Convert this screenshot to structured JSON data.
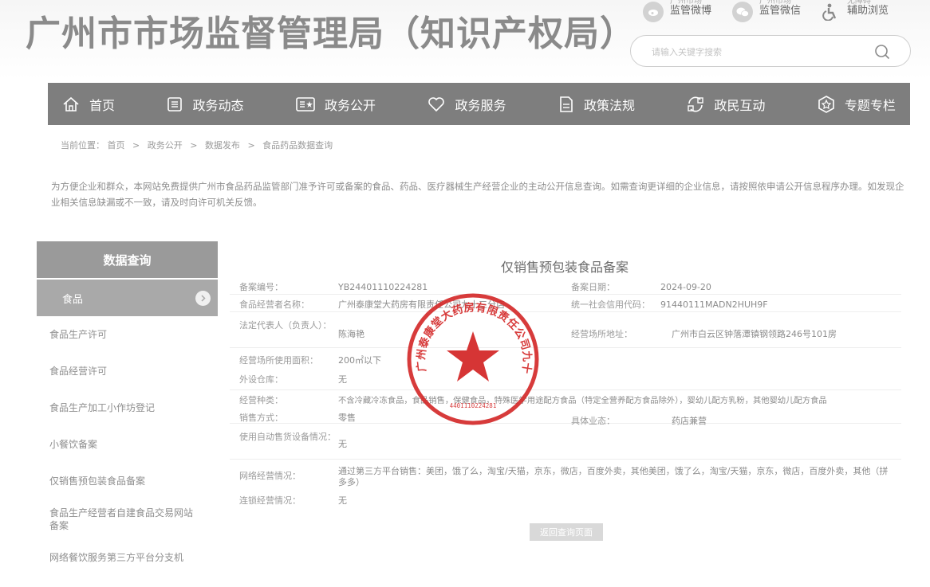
{
  "header": {
    "site_title": "广州市市场监督管理局（知识产权局）",
    "links": [
      {
        "label": "监管微博",
        "cut": "广州市场"
      },
      {
        "label": "监管微信",
        "cut": "广州市场"
      },
      {
        "label": "辅助浏览",
        "cut": "无障碍"
      }
    ],
    "search_placeholder": "请输入关键字搜索"
  },
  "nav": {
    "items": [
      {
        "label": "首页",
        "icon": "home-icon"
      },
      {
        "label": "政务动态",
        "icon": "news-icon"
      },
      {
        "label": "政务公开",
        "icon": "public-icon"
      },
      {
        "label": "政务服务",
        "icon": "heart-icon"
      },
      {
        "label": "政策法规",
        "icon": "document-icon"
      },
      {
        "label": "政民互动",
        "icon": "interaction-icon"
      },
      {
        "label": "专题专栏",
        "icon": "special-icon"
      }
    ]
  },
  "breadcrumb": {
    "prefix": "当前位置：",
    "items": [
      "首页",
      "政务公开",
      "数据发布",
      "食品药品数据查询"
    ],
    "separator": ">"
  },
  "intro": "为方便企业和群众，本网站免费提供广州市食品药品监管部门准予许可或备案的食品、药品、医疗器械生产经营企业的主动公开信息查询。如需查询更详细的企业信息，请按照依申请公开信息程序办理。如发现企业相关信息缺漏或不一致，请及时向许可机关反馈。",
  "sidebar": {
    "title": "数据查询",
    "active": "食品",
    "items": [
      "食品生产许可",
      "食品经营许可",
      "食品生产加工小作坊登记",
      "小餐饮备案",
      "仅销售预包装食品备案",
      "食品生产经营者自建食品交易网站备案",
      "网络餐饮服务第三方平台分支机"
    ]
  },
  "main": {
    "title": "仅销售预包装食品备案",
    "fields": {
      "record_no_label": "备案编号：",
      "record_no": "YB24401110224281",
      "record_date_label": "备案日期：",
      "record_date": "2024-09-20",
      "operator_label": "食品经营者名称：",
      "operator": "广州泰康堂大药房有限责任公司九十三分店",
      "credit_code_label": "统一社会信用代码：",
      "credit_code": "91440111MADN2HUH9F",
      "legal_rep_label": "法定代表人（负责人）：",
      "legal_rep": "陈海艳",
      "address_label": "经营场所地址：",
      "address": "广州市白云区钟落潭镇钢领路246号101房",
      "area_label": "经营场所使用面积：",
      "area": "200㎡以下",
      "warehouse_label": "外设仓库：",
      "warehouse": "无",
      "category_label": "经营种类：",
      "category": "不含冷藏冷冻食品，食品销售，保健食品，特殊医学用途配方食品（特定全营养配方食品除外），婴幼儿配方乳粉，其他婴幼儿配方食品",
      "sales_mode_label": "销售方式：",
      "sales_mode": "零售",
      "business_label": "具体业态：",
      "business": "药店兼营",
      "vending_label": "使用自动售货设备情况：",
      "vending": "无",
      "online_label": "网络经营情况：",
      "online": "通过第三方平台销售：美团，饿了么，淘宝/天猫，京东，微店，百度外卖，其他美团，饿了么，淘宝/天猫，京东，微店，百度外卖，其他（拼多多）",
      "chain_label": "连锁经营情况：",
      "chain": "无"
    },
    "back_button": "返回查询页面",
    "seal_text": "广州泰康堂大药房有限责任公司九十三分店",
    "seal_code": "4401110224281"
  },
  "colors": {
    "nav_bg": "#7e7e7e",
    "sidebar_head": "#9a9a9a",
    "sidebar_active": "#a9a9a9",
    "seal_red": "#d42a2a"
  }
}
